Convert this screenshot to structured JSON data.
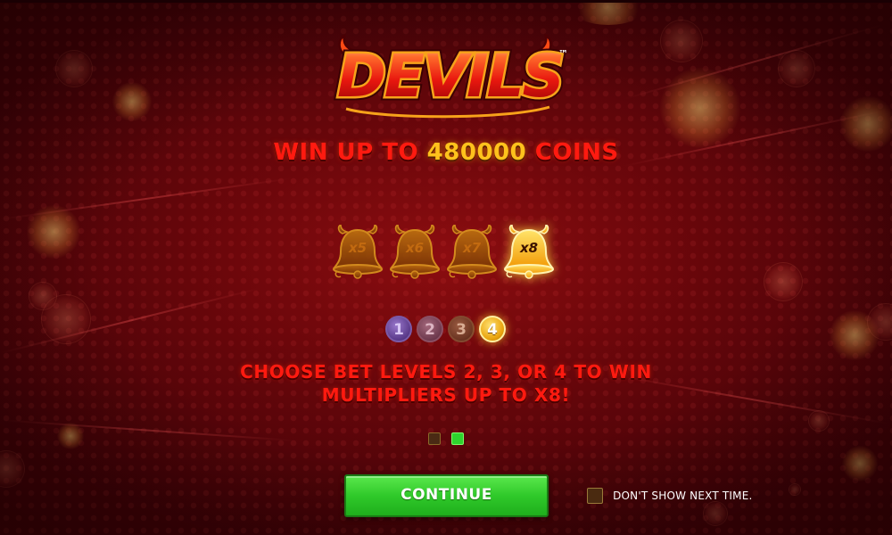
{
  "logo": {
    "text": "DEVILS",
    "trademark": "™"
  },
  "headline": {
    "prefix": "WIN UP TO",
    "amount": "480000",
    "suffix": "COINS"
  },
  "multipliers": [
    {
      "label": "x5",
      "active": false
    },
    {
      "label": "x6",
      "active": false
    },
    {
      "label": "x7",
      "active": false
    },
    {
      "label": "x8",
      "active": true
    }
  ],
  "bet_levels": [
    {
      "label": "1",
      "active": false
    },
    {
      "label": "2",
      "active": false
    },
    {
      "label": "3",
      "active": false
    },
    {
      "label": "4",
      "active": true
    }
  ],
  "description": {
    "line1": "CHOOSE BET LEVELS 2, 3, OR 4 TO WIN",
    "line2": "MULTIPLIERS UP TO X8!"
  },
  "pagination": {
    "total_pages": 2,
    "current_page": 2
  },
  "continue_button": {
    "label": "CONTINUE"
  },
  "dont_show": {
    "label": "DON'T SHOW NEXT TIME.",
    "checked": false
  },
  "colors": {
    "background": "#7a0a0d",
    "headline_red": "#ff1a10",
    "amount_gold": "#ffc21c",
    "button_green": "#2fc92a",
    "active_page_dot": "#2ed42e"
  }
}
